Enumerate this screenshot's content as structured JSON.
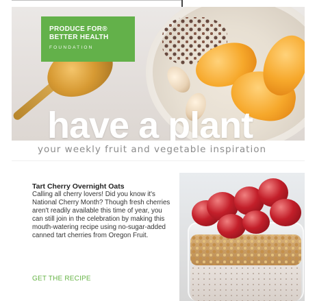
{
  "hero": {
    "badge_line1": "PRODUCE FOR®",
    "badge_line2": "BETTER HEALTH",
    "badge_line3": "FOUNDATION",
    "title": "have a plant",
    "trademark": "™",
    "tagline": "your weekly fruit and vegetable inspiration"
  },
  "article": {
    "title": "Tart Cherry Overnight Oats",
    "body": "Calling all cherry lovers! Did you know it's National Cherry Month? Though fresh cherries aren't readily available this time of year, you can still join in the celebration by making this mouth-watering recipe using no-sugar-added canned tart cherries from Oregon Fruit.",
    "cta": "GET THE RECIPE"
  },
  "colors": {
    "brand_green": "#63b14a",
    "cta_green": "#67b447"
  },
  "icons": {
    "hero_image": "oats-jar-with-peaches",
    "article_image": "cherries-granola-jar"
  }
}
